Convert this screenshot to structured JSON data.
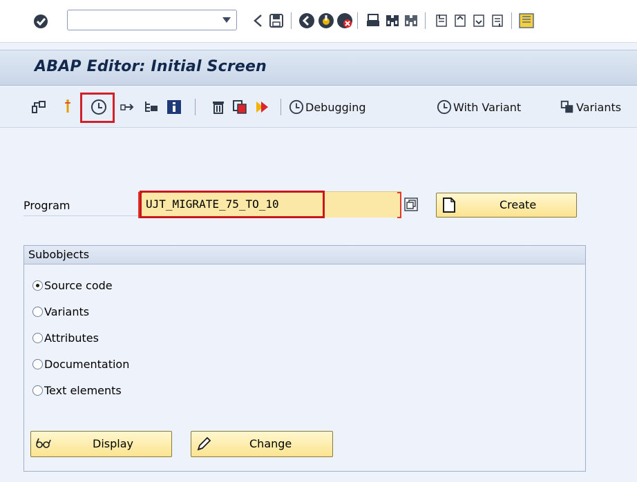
{
  "system_toolbar": {
    "command_field_value": "",
    "icons": [
      "enter-icon",
      "back-icon",
      "save-icon",
      "back-green-icon",
      "exit-icon",
      "cancel-icon",
      "print-icon",
      "find-icon",
      "find-next-icon",
      "first-page-icon",
      "previous-page-icon",
      "next-page-icon",
      "last-page-icon",
      "create-session-icon"
    ]
  },
  "title": "ABAP Editor: Initial Screen",
  "app_toolbar": {
    "debugging_label": "Debugging",
    "with_variant_label": "With Variant",
    "variants_label": "Variants"
  },
  "program": {
    "label": "Program",
    "value": "UJT_MIGRATE_75_TO_10",
    "create_label": "Create"
  },
  "subobjects": {
    "title": "Subobjects",
    "options": [
      {
        "label": "Source code",
        "checked": true
      },
      {
        "label": "Variants",
        "checked": false
      },
      {
        "label": "Attributes",
        "checked": false
      },
      {
        "label": "Documentation",
        "checked": false
      },
      {
        "label": "Text elements",
        "checked": false
      }
    ],
    "display_label": "Display",
    "change_label": "Change"
  },
  "colors": {
    "accent_red": "#d0202a",
    "button_yellow": "#fbe48f",
    "title_blue": "#12294d"
  }
}
